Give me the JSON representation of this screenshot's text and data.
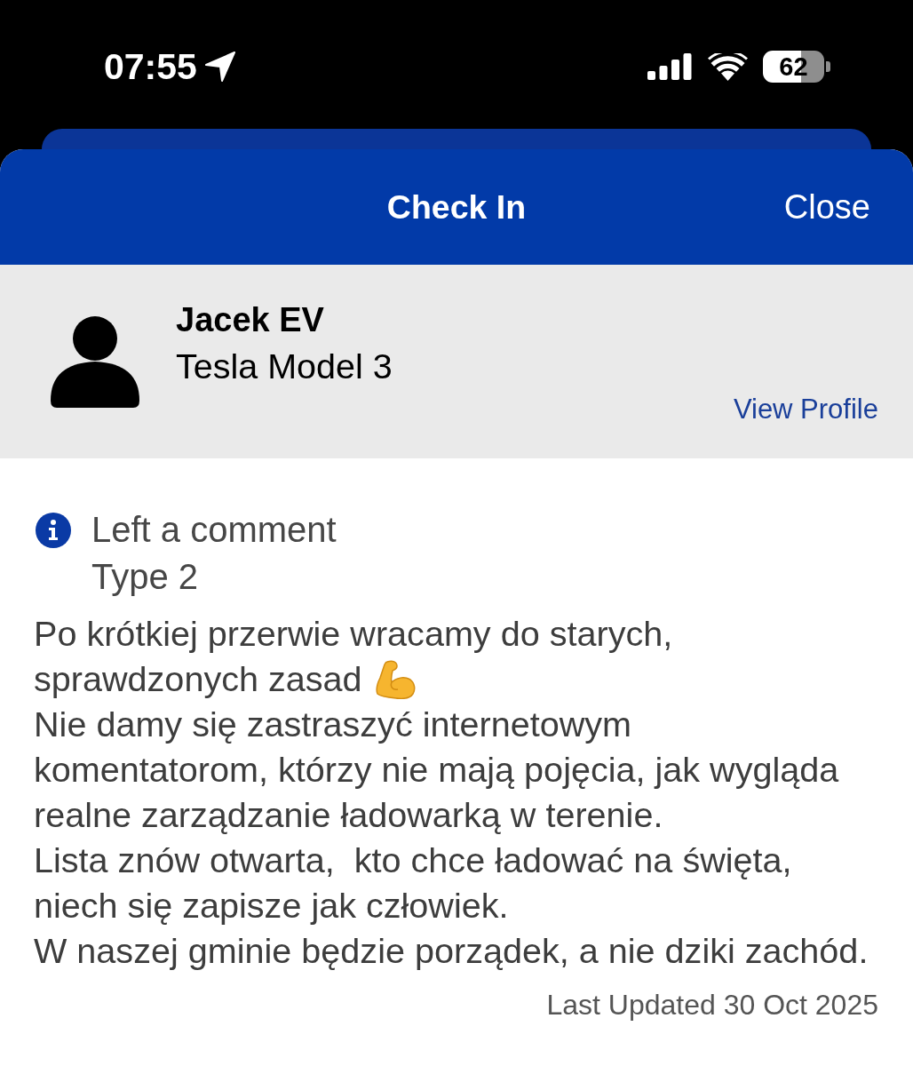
{
  "status_bar": {
    "time": "07:55",
    "battery": "62"
  },
  "header": {
    "title": "Check In",
    "close": "Close"
  },
  "profile": {
    "name": "Jacek EV",
    "vehicle": "Tesla Model 3",
    "link": "View Profile"
  },
  "checkin": {
    "action": "Left a comment",
    "connector": "Type 2",
    "comment_lines": [
      {
        "text": "Po krótkiej przerwie wracamy do starych,",
        "trailing_icon": false
      },
      {
        "text": "sprawdzonych zasad",
        "trailing_icon": true
      },
      {
        "text": "Nie damy się zastraszyć internetowym",
        "trailing_icon": false
      },
      {
        "text": "komentatorom, którzy nie mają pojęcia, jak wygląda",
        "trailing_icon": false
      },
      {
        "text": "realne zarządzanie ładowarką w terenie.",
        "trailing_icon": false
      },
      {
        "text": "Lista znów otwarta,  kto chce ładować na święta,",
        "trailing_icon": false
      },
      {
        "text": "niech się zapisze jak człowiek.",
        "trailing_icon": false
      },
      {
        "text": "W naszej gminie będzie porządek, a nie dziki zachód.",
        "trailing_icon": false
      }
    ],
    "updated": "Last Updated 30 Oct 2025"
  }
}
